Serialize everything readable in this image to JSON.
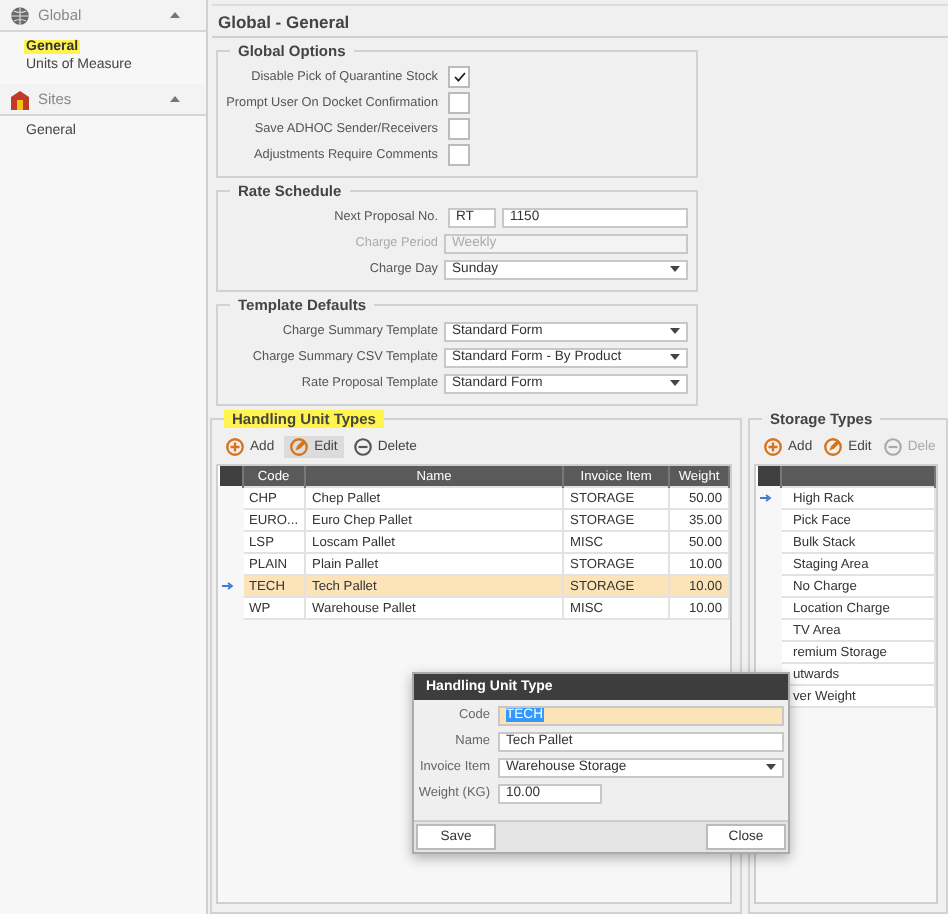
{
  "sidebar": {
    "sections": [
      {
        "title": "Global",
        "expanded": true,
        "items": [
          {
            "label": "General",
            "selected": true
          },
          {
            "label": "Units of Measure",
            "selected": false
          }
        ]
      },
      {
        "title": "Sites",
        "expanded": true,
        "items": [
          {
            "label": "General",
            "selected": false
          }
        ]
      }
    ]
  },
  "page_title": "Global - General",
  "global_options": {
    "title": "Global Options",
    "options": [
      {
        "label": "Disable Pick of Quarantine Stock",
        "checked": true
      },
      {
        "label": "Prompt User On Docket Confirmation",
        "checked": false
      },
      {
        "label": "Save ADHOC Sender/Receivers",
        "checked": false
      },
      {
        "label": "Adjustments Require Comments",
        "checked": false
      }
    ]
  },
  "rate_schedule": {
    "title": "Rate Schedule",
    "fields": [
      {
        "kind": "split",
        "label": "Next Proposal No.",
        "prefix": "RT",
        "value": "1150",
        "disabled": false
      },
      {
        "kind": "dropdown",
        "label": "Charge Period",
        "value": "Weekly",
        "disabled": true
      },
      {
        "kind": "dropdown",
        "label": "Charge Day",
        "value": "Sunday",
        "disabled": false
      }
    ]
  },
  "template_defaults": {
    "title": "Template Defaults",
    "fields": [
      {
        "label": "Charge Summary Template",
        "value": "Standard Form"
      },
      {
        "label": "Charge Summary CSV Template",
        "value": "Standard Form - By Product"
      },
      {
        "label": "Rate Proposal Template",
        "value": "Standard Form"
      }
    ]
  },
  "handling_unit_types": {
    "title": "Handling Unit Types",
    "highlighted": true,
    "toolbar": [
      {
        "label": "Add",
        "selected": false,
        "disabled": false
      },
      {
        "label": "Edit",
        "selected": true,
        "disabled": false
      },
      {
        "label": "Delete",
        "selected": false,
        "disabled": false
      }
    ],
    "columns": [
      "Code",
      "Name",
      "Invoice Item",
      "Weight"
    ],
    "rows": [
      {
        "cells": [
          "CHP",
          "Chep Pallet",
          "STORAGE",
          "50.00"
        ],
        "selected": false
      },
      {
        "cells": [
          "EURO...",
          "Euro Chep Pallet",
          "STORAGE",
          "35.00"
        ],
        "selected": false
      },
      {
        "cells": [
          "LSP",
          "Loscam Pallet",
          "MISC",
          "50.00"
        ],
        "selected": false
      },
      {
        "cells": [
          "PLAIN",
          "Plain Pallet",
          "STORAGE",
          "10.00"
        ],
        "selected": false
      },
      {
        "cells": [
          "TECH",
          "Tech Pallet",
          "STORAGE",
          "10.00"
        ],
        "selected": true
      },
      {
        "cells": [
          "WP",
          "Warehouse Pallet",
          "MISC",
          "10.00"
        ],
        "selected": false
      }
    ]
  },
  "storage_types": {
    "title": "Storage Types",
    "highlighted": false,
    "toolbar": [
      {
        "label": "Add",
        "selected": false,
        "disabled": false
      },
      {
        "label": "Edit",
        "selected": false,
        "disabled": false
      },
      {
        "label": "Dele",
        "selected": false,
        "disabled": true
      }
    ],
    "rows": [
      {
        "name": "High Rack",
        "current": true
      },
      {
        "name": "Pick Face",
        "current": false
      },
      {
        "name": "Bulk Stack",
        "current": false
      },
      {
        "name": "Staging Area",
        "current": false
      },
      {
        "name": "No Charge",
        "current": false
      },
      {
        "name": "Location Charge",
        "current": false
      },
      {
        "name": "TV Area",
        "current": false
      },
      {
        "name": "remium Storage",
        "current": false
      },
      {
        "name": "utwards"
      },
      {
        "name": "ver Weight"
      }
    ]
  },
  "dialog": {
    "title": "Handling Unit Type",
    "fields": [
      {
        "kind": "text",
        "label": "Code",
        "value": "TECH",
        "focused": true
      },
      {
        "kind": "text",
        "label": "Name",
        "value": "Tech Pallet",
        "focused": false
      },
      {
        "kind": "dropdown",
        "label": "Invoice Item",
        "value": "Warehouse Storage",
        "focused": false
      },
      {
        "kind": "short",
        "label": "Weight (KG)",
        "value": "10.00",
        "focused": false
      }
    ],
    "buttons": [
      "Save",
      "Close"
    ]
  }
}
